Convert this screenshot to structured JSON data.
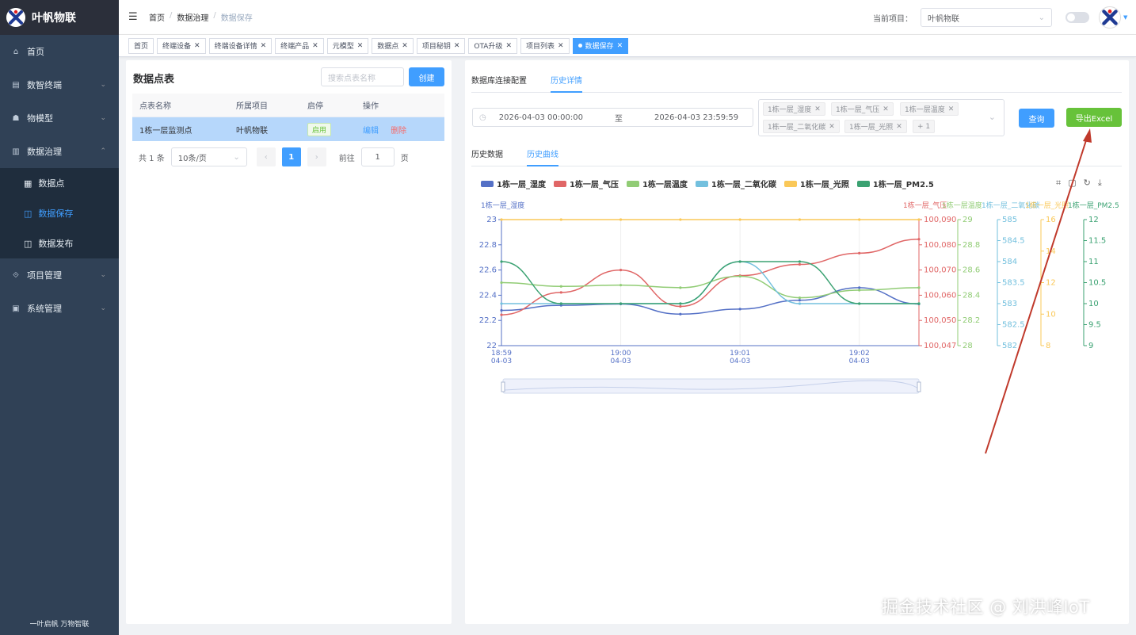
{
  "app": {
    "title": "叶帆物联",
    "footer": "一叶启帆 万物智联"
  },
  "sidebar": {
    "items": [
      {
        "label": "首页",
        "icon": "home-icon"
      },
      {
        "label": "数智终端",
        "icon": "terminal-icon"
      },
      {
        "label": "物模型",
        "icon": "model-icon"
      },
      {
        "label": "数据治理",
        "icon": "data-icon"
      },
      {
        "label": "项目管理",
        "icon": "project-icon"
      },
      {
        "label": "系统管理",
        "icon": "system-icon"
      }
    ],
    "sub_items": [
      {
        "label": "数据点"
      },
      {
        "label": "数据保存"
      },
      {
        "label": "数据发布"
      }
    ]
  },
  "header": {
    "breadcrumb": [
      "首页",
      "数据治理",
      "数据保存"
    ],
    "project_label": "当前项目：",
    "project_value": "叶帆物联"
  },
  "tags": [
    "首页",
    "终端设备",
    "终端设备详情",
    "终端产品",
    "元模型",
    "数据点",
    "项目秘钥",
    "OTA升级",
    "项目列表",
    "数据保存"
  ],
  "left_panel": {
    "title": "数据点表",
    "search_placeholder": "搜索点表名称",
    "create_label": "创建",
    "columns": [
      "点表名称",
      "所属项目",
      "启停",
      "操作"
    ],
    "rows": [
      {
        "name": "1栋一层监测点",
        "project": "叶帆物联",
        "status": "启用",
        "edit": "编辑",
        "del": "删除"
      }
    ],
    "pagination": {
      "total": "共 1 条",
      "page_size": "10条/页",
      "current": "1",
      "goto": "前往",
      "goto_value": "1",
      "page": "页"
    }
  },
  "right_panel": {
    "tabs": [
      "数据库连接配置",
      "历史详情"
    ],
    "start": "2026-04-03 00:00:00",
    "to": "至",
    "end": "2026-04-03 23:59:59",
    "selected": [
      "1栋一层_湿度",
      "1栋一层_气压",
      "1栋一层温度",
      "1栋一层_二氧化碳",
      "1栋一层_光照"
    ],
    "more": "+ 1",
    "query_label": "查询",
    "export_label": "导出Excel",
    "sub_tabs": [
      "历史数据",
      "历史曲线"
    ]
  },
  "chart_data": {
    "type": "line",
    "x": [
      "18:59\n04-03",
      "",
      "19:00\n04-03",
      "",
      "19:01\n04-03",
      "",
      "19:02\n04-03",
      ""
    ],
    "x_ticks": [
      {
        "i": 0,
        "l1": "18:59",
        "l2": "04-03"
      },
      {
        "i": 2,
        "l1": "19:00",
        "l2": "04-03"
      },
      {
        "i": 4,
        "l1": "19:01",
        "l2": "04-03"
      },
      {
        "i": 6,
        "l1": "19:02",
        "l2": "04-03"
      }
    ],
    "series": [
      {
        "name": "1栋一层_湿度",
        "color": "#5470c6",
        "axis": 0,
        "values": [
          22.28,
          22.32,
          22.33,
          22.25,
          22.29,
          22.36,
          22.46,
          22.33
        ]
      },
      {
        "name": "1栋一层_气压",
        "color": "#e06666",
        "axis": 1,
        "values": [
          100058,
          100066,
          100074,
          100061,
          100072,
          100076,
          100080,
          100085
        ]
      },
      {
        "name": "1栋一层温度",
        "color": "#91cc75",
        "axis": 2,
        "values": [
          28.5,
          28.47,
          28.48,
          28.46,
          28.55,
          28.38,
          28.44,
          28.46
        ]
      },
      {
        "name": "1栋一层_二氧化碳",
        "color": "#73c0de",
        "axis": 3,
        "values": [
          583,
          583,
          583,
          583,
          584,
          583,
          583,
          583
        ]
      },
      {
        "name": "1栋一层_光照",
        "color": "#fac858",
        "axis": 4,
        "values": [
          16,
          16,
          16,
          16,
          16,
          16,
          16,
          16
        ]
      },
      {
        "name": "1栋一层_PM2.5",
        "color": "#3ba272",
        "axis": 5,
        "values": [
          11,
          10,
          10,
          10,
          11,
          11,
          10,
          10
        ]
      }
    ],
    "axes": [
      {
        "name": "1栋一层_湿度",
        "color": "#5470c6",
        "min": 22,
        "max": 23,
        "ticks": [
          "23",
          "22.8",
          "22.6",
          "22.4",
          "22.2",
          "22"
        ]
      },
      {
        "name": "1栋一层_气压",
        "color": "#e06666",
        "min": 100047,
        "max": 100092,
        "ticks": [
          "100,090",
          "100,080",
          "100,070",
          "100,060",
          "100,050",
          "100,047"
        ]
      },
      {
        "name": "1栋一层温度",
        "color": "#91cc75",
        "min": 28,
        "max": 29,
        "ticks": [
          "29",
          "28.8",
          "28.6",
          "28.4",
          "28.2",
          "28"
        ]
      },
      {
        "name": "1栋一层_二氧化碳",
        "color": "#73c0de",
        "min": 582,
        "max": 585,
        "ticks": [
          "585",
          "584.5",
          "584",
          "583.5",
          "583",
          "582.5",
          "582"
        ]
      },
      {
        "name": "1栋一层_光照",
        "color": "#fac858",
        "min": 8,
        "max": 16,
        "ticks": [
          "16",
          "14",
          "12",
          "10",
          "8"
        ]
      },
      {
        "name": "1栋一层_PM2.5",
        "color": "#3ba272",
        "min": 9,
        "max": 12,
        "ticks": [
          "12",
          "11.5",
          "11",
          "10.5",
          "10",
          "9.5",
          "9"
        ]
      }
    ]
  },
  "watermark": "掘金技术社区 @ 刘洪峰IoT"
}
